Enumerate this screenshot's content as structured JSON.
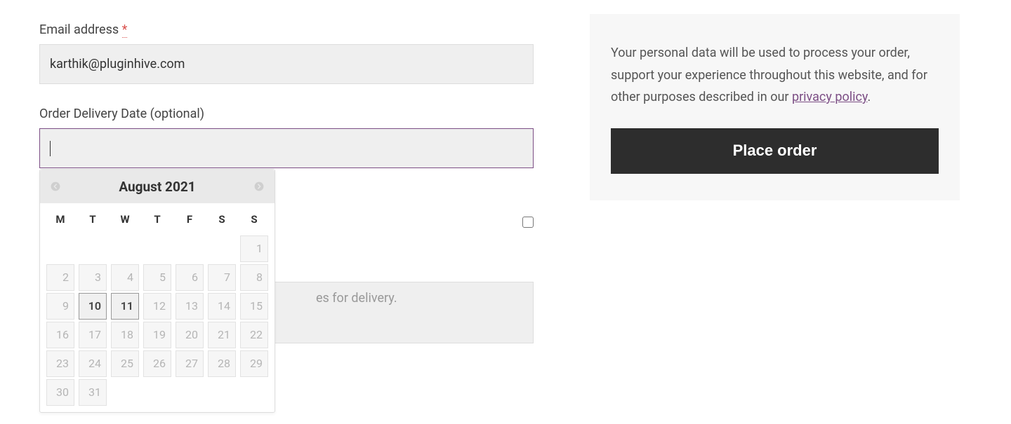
{
  "form": {
    "email_label": "Email address ",
    "email_required": "*",
    "email_value": "karthik@pluginhive.com",
    "date_label": "Order Delivery Date (optional)",
    "date_value": "",
    "ship_question_suffix": "?",
    "notes_fragment": "es for delivery."
  },
  "datepicker": {
    "title": "August 2021",
    "day_names": [
      "M",
      "T",
      "W",
      "T",
      "F",
      "S",
      "S"
    ],
    "weeks": [
      [
        null,
        null,
        null,
        null,
        null,
        null,
        {
          "n": 1,
          "e": false
        }
      ],
      [
        {
          "n": 2,
          "e": false
        },
        {
          "n": 3,
          "e": false
        },
        {
          "n": 4,
          "e": false
        },
        {
          "n": 5,
          "e": false
        },
        {
          "n": 6,
          "e": false
        },
        {
          "n": 7,
          "e": false
        },
        {
          "n": 8,
          "e": false
        }
      ],
      [
        {
          "n": 9,
          "e": false
        },
        {
          "n": 10,
          "e": true,
          "hl": true
        },
        {
          "n": 11,
          "e": true,
          "hl": true
        },
        {
          "n": 12,
          "e": false
        },
        {
          "n": 13,
          "e": false
        },
        {
          "n": 14,
          "e": false
        },
        {
          "n": 15,
          "e": false
        }
      ],
      [
        {
          "n": 16,
          "e": false
        },
        {
          "n": 17,
          "e": false
        },
        {
          "n": 18,
          "e": false
        },
        {
          "n": 19,
          "e": false
        },
        {
          "n": 20,
          "e": false
        },
        {
          "n": 21,
          "e": false
        },
        {
          "n": 22,
          "e": false
        }
      ],
      [
        {
          "n": 23,
          "e": false
        },
        {
          "n": 24,
          "e": false
        },
        {
          "n": 25,
          "e": false
        },
        {
          "n": 26,
          "e": false
        },
        {
          "n": 27,
          "e": false
        },
        {
          "n": 28,
          "e": false
        },
        {
          "n": 29,
          "e": false
        }
      ],
      [
        {
          "n": 30,
          "e": false
        },
        {
          "n": 31,
          "e": false
        },
        null,
        null,
        null,
        null,
        null
      ]
    ]
  },
  "sidebar": {
    "privacy_text_pre": "Your personal data will be used to process your order, support your experience throughout this website, and for other purposes described in our ",
    "privacy_link": "privacy policy",
    "privacy_text_post": ".",
    "place_order": "Place order"
  }
}
